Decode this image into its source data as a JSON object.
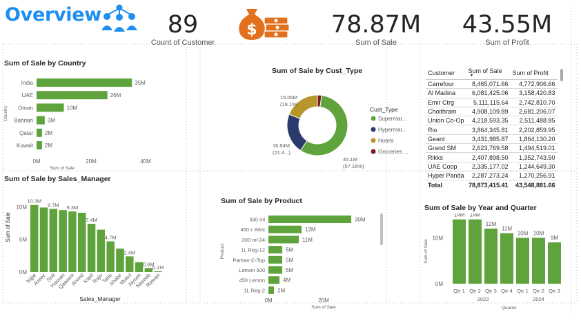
{
  "header": {
    "title": "Overview",
    "customers_icon": "people-network-icon",
    "money_icon": "money-bag-icon"
  },
  "kpis": [
    {
      "value": "89",
      "label": "Count of Customer"
    },
    {
      "value": "78.87M",
      "label": "Sum of Sale"
    },
    {
      "value": "43.55M",
      "label": "Sum of Profit"
    }
  ],
  "colors": {
    "bar": "#5ea33b",
    "title_blue": "#1f8ef1",
    "navy": "#2a3a6b",
    "gold": "#b8962a",
    "maroon": "#7a1f1f"
  },
  "chart_data": [
    {
      "id": "country",
      "type": "bar",
      "orientation": "horizontal",
      "title": "Sum of Sale by Country",
      "xlabel": "Sum of Sale",
      "ylabel": "Country",
      "categories": [
        "India",
        "UAE",
        "Oman",
        "Bahrain",
        "Qatar",
        "Kuwait"
      ],
      "values": [
        35,
        26,
        10,
        3,
        2,
        2
      ],
      "data_labels": [
        "35M",
        "26M",
        "10M",
        "3M",
        "2M",
        "2M"
      ],
      "x_ticks": [
        "0M",
        "20M",
        "40M"
      ],
      "xlim": [
        0,
        40
      ]
    },
    {
      "id": "cust_type",
      "type": "pie",
      "style": "donut",
      "title": "Sum of Sale by Cust_Type",
      "legend_title": "Cust_Type",
      "legend_placement": "right",
      "categories": [
        "Supermar...",
        "Hypermar...",
        "Hotels",
        "Groceries ..."
      ],
      "values": [
        45.1,
        16.94,
        15.06,
        1.77
      ],
      "data_labels": [
        {
          "value": "45.1M",
          "pct": "(57.18%)"
        },
        {
          "value": "16.94M",
          "pct": "(21.4...)"
        },
        {
          "value": "15.06M",
          "pct": "(19.1%)"
        }
      ]
    },
    {
      "id": "table",
      "type": "table",
      "columns": [
        "Customer",
        "Sum of Sale",
        "Sum of Profit"
      ],
      "rows": [
        [
          "Carrefour",
          "8,465,071.66",
          "4,772,906.66"
        ],
        [
          "Al Madina",
          "6,081,425.06",
          "3,158,420.83"
        ],
        [
          "Emir Ctrg",
          "5,111,115.64",
          "2,742,810.70"
        ],
        [
          "Choithram",
          "4,908,109.89",
          "2,681,206.07"
        ],
        [
          "Union Co-Op",
          "4,218,593.35",
          "2,511,488.85"
        ],
        [
          "Rio",
          "3,864,345.81",
          "2,202,859.95"
        ],
        [
          "Geant",
          "3,431,985.87",
          "1,864,130.20"
        ],
        [
          "Grand SM",
          "2,623,769.58",
          "1,494,519.01"
        ],
        [
          "Rikks",
          "2,407,898.50",
          "1,352,743.50"
        ],
        [
          "UAE Coop",
          "2,335,177.02",
          "1,244,649.30"
        ],
        [
          "Hyper Panda",
          "2,287,273.24",
          "1,270,256.91"
        ]
      ],
      "total": [
        "Total",
        "78,873,415.41",
        "43,548,881.66"
      ]
    },
    {
      "id": "manager",
      "type": "bar",
      "title": "Sum of Sale by Sales_Manager",
      "xlabel": "Sales_Manager",
      "ylabel": "Sum of Sale",
      "categories": [
        "Nijjie",
        "Azeez",
        "Sinil",
        "Hassan",
        "Qaseem",
        "Arvind",
        "Kapil",
        "Rajiv",
        "Tahir",
        "Shabir",
        "Mukul",
        "Jayson",
        "Naseeb",
        "Rizwan"
      ],
      "values": [
        10.3,
        9.9,
        9.7,
        9.5,
        9.3,
        9.1,
        7.4,
        6.5,
        4.7,
        3.6,
        2.4,
        1.5,
        0.6,
        0.1
      ],
      "data_labels": [
        "10.3M",
        "",
        "9.7M",
        "",
        "9.3M",
        "",
        "7.4M",
        "",
        "4.7M",
        "",
        "2.4M",
        "",
        "0.6M",
        "0.1M"
      ],
      "y_ticks": [
        "0M",
        "5M",
        "10M"
      ],
      "ylim": [
        0,
        11
      ]
    },
    {
      "id": "product",
      "type": "bar",
      "orientation": "horizontal",
      "title": "Sum of Sale by Product",
      "xlabel": "Sum of Sale",
      "ylabel": "Product",
      "categories": [
        "330 ml",
        "450 L-Mint",
        "200 ml-24",
        "1L Reg-12",
        "Partner C-Top",
        "Lemon 500",
        "450 Lemon",
        "1L Reg-2"
      ],
      "values": [
        30,
        12,
        11,
        5,
        5,
        5,
        4,
        2
      ],
      "data_labels": [
        "30M",
        "12M",
        "11M",
        "5M",
        "5M",
        "5M",
        "4M",
        "2M"
      ],
      "x_ticks": [
        "0M",
        "20M"
      ],
      "xlim": [
        0,
        40
      ]
    },
    {
      "id": "yearq",
      "type": "bar",
      "title": "Sum of Sale by Year and Quarter",
      "xlabel": "Quarter",
      "ylabel": "Sum of Sale",
      "categories": [
        "Qtr 1",
        "Qtr 2",
        "Qtr 3",
        "Qtr 4",
        "Qtr 1",
        "Qtr 2",
        "Qtr 3"
      ],
      "groups": [
        {
          "label": "2023",
          "count": 4
        },
        {
          "label": "2024",
          "count": 3
        }
      ],
      "values": [
        14,
        14,
        12,
        11,
        10,
        10,
        9
      ],
      "data_labels": [
        "14M",
        "14M",
        "12M",
        "11M",
        "10M",
        "10M",
        "9M"
      ],
      "y_ticks": [
        "0M",
        "10M"
      ],
      "ylim": [
        0,
        15
      ]
    }
  ]
}
